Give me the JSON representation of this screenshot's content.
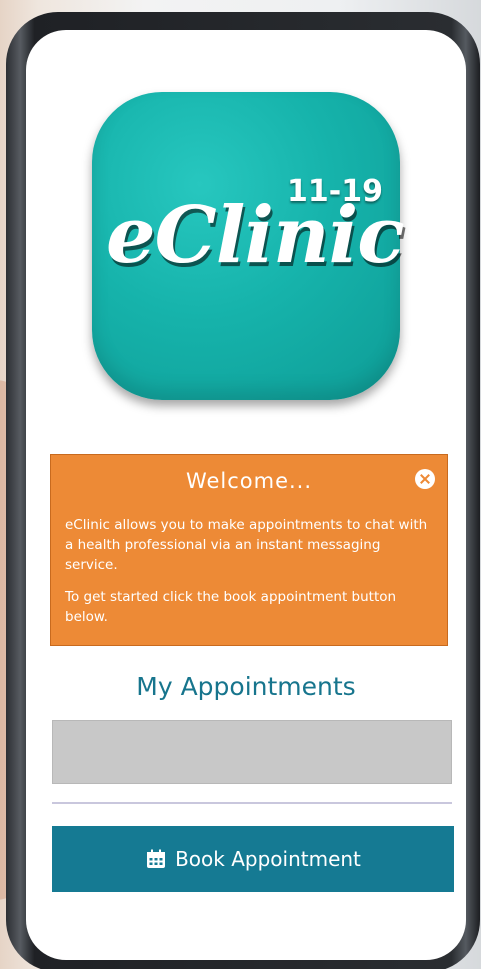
{
  "logo": {
    "age_range": "11-19",
    "wordmark": "eClinic",
    "color": "#16b3ab"
  },
  "welcome": {
    "title": "Welcome...",
    "close_icon": "close-icon",
    "paragraphs": [
      "eClinic allows you to make appointments to chat with a health professional via an instant messaging service.",
      "To get started click the book appointment button below."
    ],
    "color": "#ed8a36"
  },
  "appointments": {
    "title": "My Appointments"
  },
  "book_button": {
    "icon": "calendar-icon",
    "label": "Book Appointment",
    "color": "#157a93"
  }
}
